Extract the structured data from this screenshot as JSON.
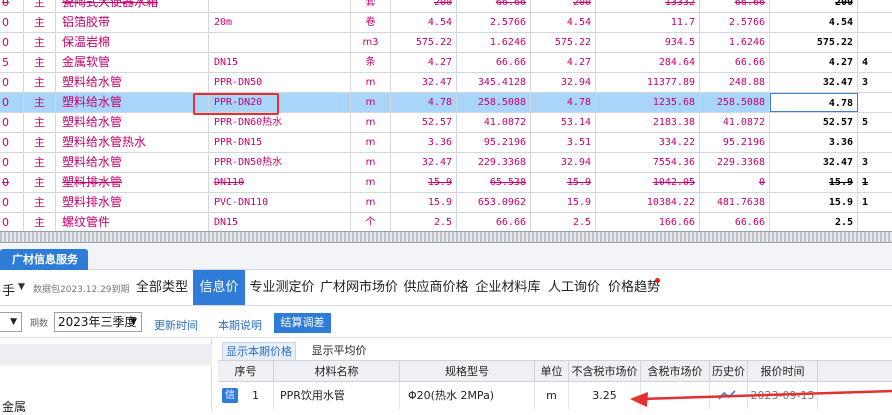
{
  "grid": {
    "rows": [
      {
        "c0": "0",
        "c1": "主",
        "c2": "瓷陶式大便器水箱",
        "c3": "",
        "c4": "套",
        "c5": "200",
        "c6": "66.66",
        "c7": "200",
        "c8": "13332",
        "c9": "66.66",
        "c10": "200",
        "c11": "",
        "state": "struck"
      },
      {
        "c0": "0",
        "c1": "主",
        "c2": "铝箔胶带",
        "c3": "20m",
        "c4": "卷",
        "c5": "4.54",
        "c6": "2.5766",
        "c7": "4.54",
        "c8": "11.7",
        "c9": "2.5766",
        "c10": "4.54",
        "c11": ""
      },
      {
        "c0": "0",
        "c1": "主",
        "c2": "保温岩棉",
        "c3": "",
        "c4": "m3",
        "c5": "575.22",
        "c6": "1.6246",
        "c7": "575.22",
        "c8": "934.5",
        "c9": "1.6246",
        "c10": "575.22",
        "c11": ""
      },
      {
        "c0": "5",
        "c1": "主",
        "c2": "金属软管",
        "c3": "DN15",
        "c4": "条",
        "c5": "4.27",
        "c6": "66.66",
        "c7": "4.27",
        "c8": "284.64",
        "c9": "66.66",
        "c10": "4.27",
        "c11": "4"
      },
      {
        "c0": "0",
        "c1": "主",
        "c2": "塑料给水管",
        "c3": "PPR-DN50",
        "c4": "m",
        "c5": "32.47",
        "c6": "345.4128",
        "c7": "32.94",
        "c8": "11377.89",
        "c9": "248.88",
        "c10": "32.47",
        "c11": "3"
      },
      {
        "c0": "0",
        "c1": "主",
        "c2": "塑料给水管",
        "c3": "PPR-DN20",
        "c4": "m",
        "c5": "4.78",
        "c6": "258.5088",
        "c7": "4.78",
        "c8": "1235.68",
        "c9": "258.5088",
        "c10": "4.78",
        "c11": "",
        "state": "selected"
      },
      {
        "c0": "0",
        "c1": "主",
        "c2": "塑料给水管",
        "c3": "PPR-DN60热水",
        "c4": "m",
        "c5": "52.57",
        "c6": "41.0872",
        "c7": "53.14",
        "c8": "2183.38",
        "c9": "41.0872",
        "c10": "52.57",
        "c11": "5"
      },
      {
        "c0": "0",
        "c1": "主",
        "c2": "塑料给水管热水",
        "c3": "PPR-DN15",
        "c4": "m",
        "c5": "3.36",
        "c6": "95.2196",
        "c7": "3.51",
        "c8": "334.22",
        "c9": "95.2196",
        "c10": "3.36",
        "c11": ""
      },
      {
        "c0": "0",
        "c1": "主",
        "c2": "塑料给水管",
        "c3": "PPR-DN50热水",
        "c4": "m",
        "c5": "32.47",
        "c6": "229.3368",
        "c7": "32.94",
        "c8": "7554.36",
        "c9": "229.3368",
        "c10": "32.47",
        "c11": "3"
      },
      {
        "c0": "0",
        "c1": "主",
        "c2": "塑料排水管",
        "c3": "DN110",
        "c4": "m",
        "c5": "15.9",
        "c6": "65.538",
        "c7": "15.9",
        "c8": "1042.05",
        "c9": "0",
        "c10": "15.9",
        "c11": "1",
        "state": "struck"
      },
      {
        "c0": "0",
        "c1": "主",
        "c2": "塑料排水管",
        "c3": "PVC-DN110",
        "c4": "m",
        "c5": "15.9",
        "c6": "653.0962",
        "c7": "15.9",
        "c8": "10384.22",
        "c9": "481.7638",
        "c10": "15.9",
        "c11": "1"
      },
      {
        "c0": "0",
        "c1": "主",
        "c2": "螺纹管件",
        "c3": "DN15",
        "c4": "个",
        "c5": "2.5",
        "c6": "66.66",
        "c7": "2.5",
        "c8": "166.66",
        "c9": "66.66",
        "c10": "2.5",
        "c11": ""
      }
    ]
  },
  "panel": {
    "tab_label": "广材信息服务"
  },
  "nav": {
    "prefix": "手",
    "arrow": "▼",
    "date_text": "数据包2023.12.29到期",
    "tabs": [
      "全部类型",
      "信息价",
      "专业测定价",
      "广材网市场价",
      "供应商价格",
      "企业材料库",
      "人工询价",
      "价格趋势"
    ],
    "active_tab": "信息价"
  },
  "filters": {
    "period_label": "期数",
    "period_value": "2023年三季度",
    "update_time": "更新时间",
    "period_note": "本期说明",
    "settle_button": "结算调差"
  },
  "left_tree": {
    "leaf_label": "金属"
  },
  "result": {
    "subtabs": [
      "显示本期价格",
      "显示平均价"
    ],
    "headers": [
      "序号",
      "材料名称",
      "规格型号",
      "单位",
      "不含税市场价",
      "含税市场价",
      "历史价",
      "报价时间"
    ],
    "rows": [
      {
        "badge": "信",
        "index": "1",
        "name": "PPR饮用水管",
        "spec": "Φ20(热水 2MPa)",
        "unit": "m",
        "price_ex_tax": "3.25",
        "price_inc_tax": "",
        "history": "",
        "quote_time": "2023-09-15"
      }
    ]
  },
  "colors": {
    "accent": "#2f7bd8",
    "selected_row": "#a9d5fb",
    "row_text": "#c8006e",
    "highlight_red": "#e53030"
  }
}
